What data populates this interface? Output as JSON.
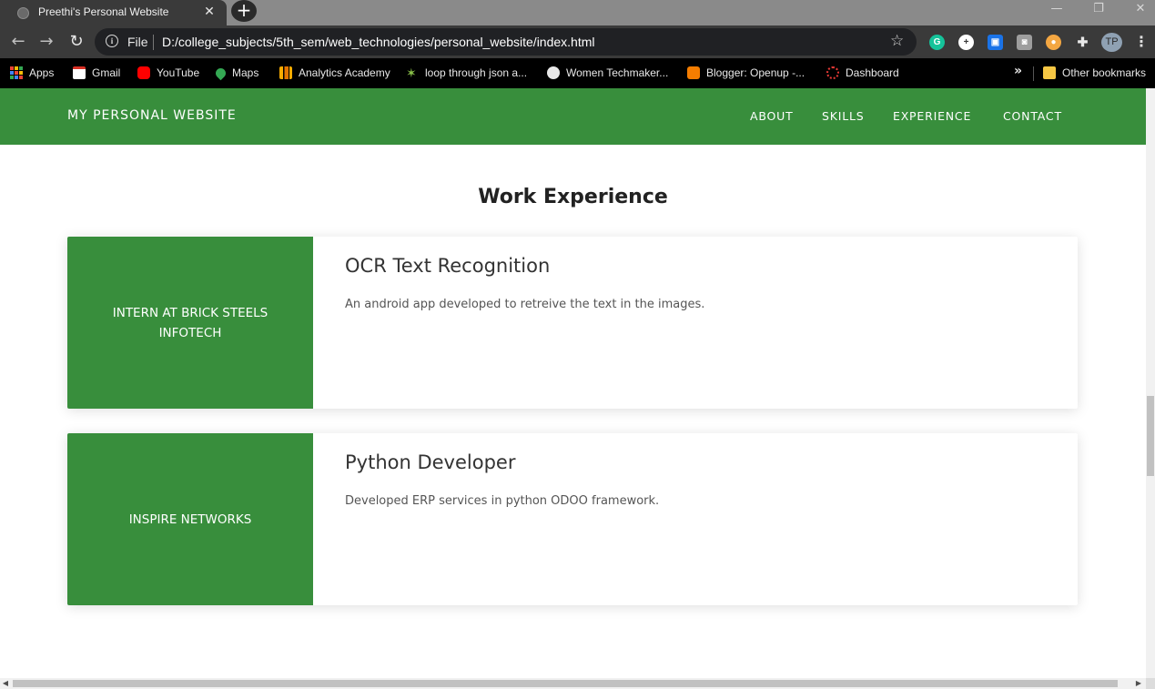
{
  "browser": {
    "tab": {
      "title": "Preethi's Personal Website",
      "close_glyph": "✕"
    },
    "new_tab_glyph": "+",
    "window_controls": {
      "minimize": "—",
      "restore": "❐",
      "close": "✕"
    },
    "nav": {
      "back": "←",
      "forward": "→",
      "reload": "↻"
    },
    "omnibox": {
      "info_glyph": "i",
      "scheme_label": "File",
      "url": "D:/college_subjects/5th_sem/web_technologies/personal_website/index.html",
      "star_glyph": "☆"
    },
    "extensions": [
      {
        "name": "grammarly-icon",
        "glyph": "G",
        "color": "#15c39a"
      },
      {
        "name": "plus-extension-icon",
        "glyph": "+",
        "color": "#ffffff"
      },
      {
        "name": "blue-extension-icon",
        "glyph": "▣",
        "color": "#1a73e8"
      },
      {
        "name": "camera-icon",
        "glyph": "◙",
        "color": "#bdbdbd"
      },
      {
        "name": "orange-extension-icon",
        "glyph": "●",
        "color": "#f4a742"
      },
      {
        "name": "puzzle-icon",
        "glyph": "✚",
        "color": "#e8e8e8"
      }
    ],
    "profile_initials": "TP",
    "menu_glyph": "⋮",
    "bookmarks": [
      {
        "label": "Apps",
        "icon": "apps-grid-icon"
      },
      {
        "label": "Gmail",
        "icon": "gmail-icon",
        "color": "#d93025"
      },
      {
        "label": "YouTube",
        "icon": "youtube-icon",
        "color": "#ff0000"
      },
      {
        "label": "Maps",
        "icon": "maps-icon",
        "color": "#34a853"
      },
      {
        "label": "Analytics Academy",
        "icon": "analytics-icon",
        "color": "#f9ab00"
      },
      {
        "label": "loop through json a...",
        "icon": "loop-icon",
        "color": "#8bc34a"
      },
      {
        "label": "Women Techmaker...",
        "icon": "globe-icon",
        "color": "#e8e8e8"
      },
      {
        "label": "Blogger: Openup -...",
        "icon": "blogger-icon",
        "color": "#f57d00"
      },
      {
        "label": "Dashboard",
        "icon": "dashboard-icon",
        "color": "#e53935"
      }
    ],
    "bookmarks_overflow": "»",
    "other_bookmarks": "Other bookmarks"
  },
  "site": {
    "brand": "MY PERSONAL WEBSITE",
    "nav_links": [
      "ABOUT",
      "SKILLS",
      "EXPERIENCE",
      "CONTACT"
    ],
    "accent": "#388e3c",
    "section_title": "Work Experience",
    "experiences": [
      {
        "company": "INTERN AT BRICK STEELS INFOTECH",
        "role": "OCR Text Recognition",
        "description": "An android app developed to retreive the text in the images."
      },
      {
        "company": "INSPIRE NETWORKS",
        "role": "Python Developer",
        "description": "Developed ERP services in python ODOO framework."
      }
    ]
  }
}
